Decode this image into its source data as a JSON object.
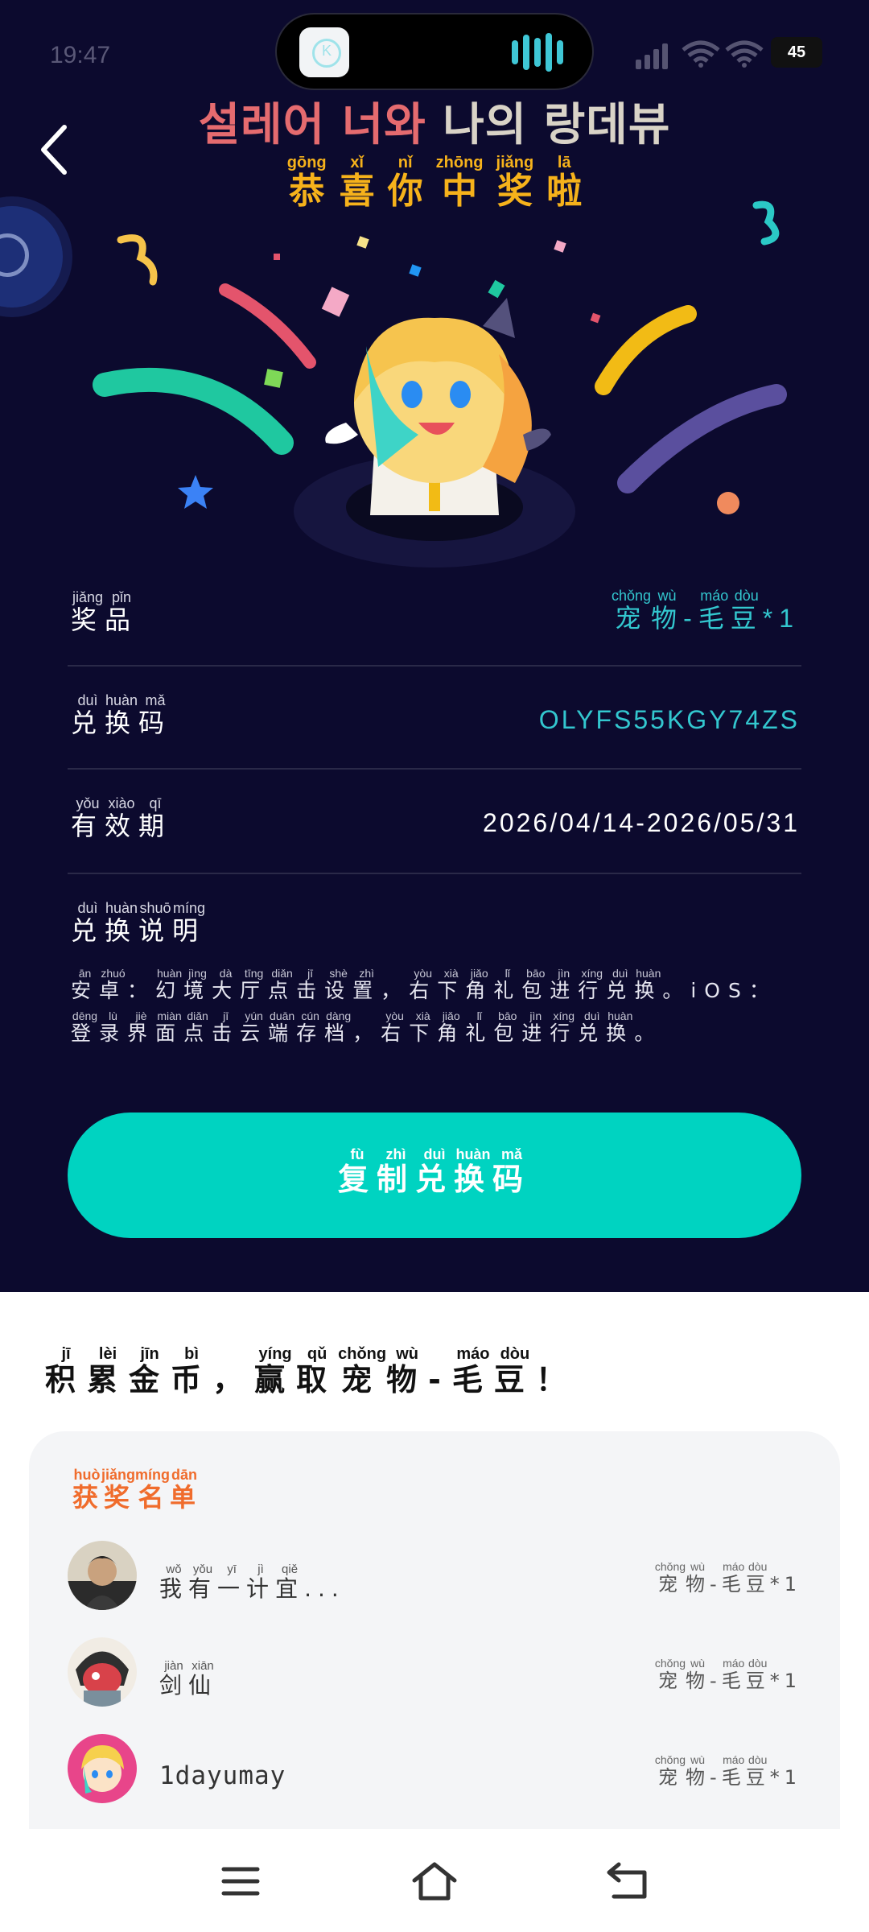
{
  "status_bar": {
    "time": "19:47",
    "battery": "45"
  },
  "game_title": {
    "part1": "설레어 너와",
    "part2": "나의 랑데뷰"
  },
  "congrats": [
    {
      "c": "恭",
      "p": "gōng"
    },
    {
      "c": "喜",
      "p": "xǐ"
    },
    {
      "c": "你",
      "p": "nǐ"
    },
    {
      "c": "中",
      "p": "zhōng"
    },
    {
      "c": "奖",
      "p": "jiǎng"
    },
    {
      "c": "啦",
      "p": "lā"
    }
  ],
  "rows": [
    {
      "label": [
        {
          "c": "奖",
          "p": "jiǎng"
        },
        {
          "c": "品",
          "p": "pǐn"
        }
      ],
      "value_ruby": [
        {
          "c": "宠",
          "p": "chǒng"
        },
        {
          "c": "物",
          "p": "wù"
        },
        {
          "c": "-",
          "p": ""
        },
        {
          "c": "毛",
          "p": "máo"
        },
        {
          "c": "豆",
          "p": "dòu"
        },
        {
          "c": "*1",
          "p": ""
        }
      ]
    },
    {
      "label": [
        {
          "c": "兑",
          "p": "duì"
        },
        {
          "c": "换",
          "p": "huàn"
        },
        {
          "c": "码",
          "p": "mǎ"
        }
      ],
      "value": "OLYFS55KGY74ZS"
    },
    {
      "label": [
        {
          "c": "有",
          "p": "yǒu"
        },
        {
          "c": "效",
          "p": "xiào"
        },
        {
          "c": "期",
          "p": "qī"
        }
      ],
      "value": "2026/04/14-2026/05/31"
    }
  ],
  "explain": {
    "title": [
      {
        "c": "兑",
        "p": "duì"
      },
      {
        "c": "换",
        "p": "huàn"
      },
      {
        "c": "说",
        "p": "shuō"
      },
      {
        "c": "明",
        "p": "míng"
      }
    ],
    "line1": [
      {
        "c": "安",
        "p": "ān"
      },
      {
        "c": "卓",
        "p": "zhuó"
      },
      {
        "c": "：",
        "p": ""
      },
      {
        "c": "幻",
        "p": "huàn"
      },
      {
        "c": "境",
        "p": "jìng"
      },
      {
        "c": "大",
        "p": "dà"
      },
      {
        "c": "厅",
        "p": "tīng"
      },
      {
        "c": "点",
        "p": "diǎn"
      },
      {
        "c": "击",
        "p": "jī"
      },
      {
        "c": "设",
        "p": "shè"
      },
      {
        "c": "置",
        "p": "zhì"
      },
      {
        "c": "，",
        "p": ""
      },
      {
        "c": "右",
        "p": "yòu"
      },
      {
        "c": "下",
        "p": "xià"
      },
      {
        "c": "角",
        "p": "jiǎo"
      },
      {
        "c": "礼",
        "p": "lǐ"
      },
      {
        "c": "包",
        "p": "bāo"
      },
      {
        "c": "进",
        "p": "jìn"
      },
      {
        "c": "行",
        "p": "xíng"
      },
      {
        "c": "兑",
        "p": "duì"
      },
      {
        "c": "换",
        "p": "huàn"
      },
      {
        "c": "。",
        "p": ""
      },
      {
        "c": "iOS：",
        "p": ""
      }
    ],
    "line2": [
      {
        "c": "登",
        "p": "dēng"
      },
      {
        "c": "录",
        "p": "lù"
      },
      {
        "c": "界",
        "p": "jiè"
      },
      {
        "c": "面",
        "p": "miàn"
      },
      {
        "c": "点",
        "p": "diǎn"
      },
      {
        "c": "击",
        "p": "jī"
      },
      {
        "c": "云",
        "p": "yún"
      },
      {
        "c": "端",
        "p": "duān"
      },
      {
        "c": "存",
        "p": "cún"
      },
      {
        "c": "档",
        "p": "dàng"
      },
      {
        "c": "，",
        "p": ""
      },
      {
        "c": "右",
        "p": "yòu"
      },
      {
        "c": "下",
        "p": "xià"
      },
      {
        "c": "角",
        "p": "jiǎo"
      },
      {
        "c": "礼",
        "p": "lǐ"
      },
      {
        "c": "包",
        "p": "bāo"
      },
      {
        "c": "进",
        "p": "jìn"
      },
      {
        "c": "行",
        "p": "xíng"
      },
      {
        "c": "兑",
        "p": "duì"
      },
      {
        "c": "换",
        "p": "huàn"
      },
      {
        "c": "。",
        "p": ""
      }
    ]
  },
  "copy_button": [
    {
      "c": "复",
      "p": "fù"
    },
    {
      "c": "制",
      "p": "zhì"
    },
    {
      "c": "兑",
      "p": "duì"
    },
    {
      "c": "换",
      "p": "huàn"
    },
    {
      "c": "码",
      "p": "mǎ"
    }
  ],
  "headline": [
    {
      "c": "积",
      "p": "jī"
    },
    {
      "c": "累",
      "p": "lèi"
    },
    {
      "c": "金",
      "p": "jīn"
    },
    {
      "c": "币",
      "p": "bì"
    },
    {
      "c": "，",
      "p": ""
    },
    {
      "c": "赢",
      "p": "yíng"
    },
    {
      "c": "取",
      "p": "qǔ"
    },
    {
      "c": "宠",
      "p": "chǒng"
    },
    {
      "c": "物",
      "p": "wù"
    },
    {
      "c": "-",
      "p": ""
    },
    {
      "c": "毛",
      "p": "máo"
    },
    {
      "c": "豆",
      "p": "dòu"
    },
    {
      "c": "！",
      "p": ""
    }
  ],
  "winners": {
    "title": [
      {
        "c": "获",
        "p": "huò"
      },
      {
        "c": "奖",
        "p": "jiǎng"
      },
      {
        "c": "名",
        "p": "míng"
      },
      {
        "c": "单",
        "p": "dān"
      }
    ],
    "prize": [
      {
        "c": "宠",
        "p": "chǒng"
      },
      {
        "c": "物",
        "p": "wù"
      },
      {
        "c": "-",
        "p": ""
      },
      {
        "c": "毛",
        "p": "máo"
      },
      {
        "c": "豆",
        "p": "dòu"
      },
      {
        "c": "*1",
        "p": ""
      }
    ],
    "items": [
      {
        "name_ruby": [
          {
            "c": "我",
            "p": "wǒ"
          },
          {
            "c": "有",
            "p": "yǒu"
          },
          {
            "c": "一",
            "p": "yī"
          },
          {
            "c": "计",
            "p": "jì"
          },
          {
            "c": "宜",
            "p": "qiě"
          },
          {
            "c": "...",
            "p": ""
          }
        ]
      },
      {
        "name_ruby": [
          {
            "c": "剑",
            "p": "jiàn"
          },
          {
            "c": "仙",
            "p": "xiān"
          }
        ]
      },
      {
        "name": "1dayumay"
      }
    ]
  },
  "colors": {
    "background_dark": "#0c0a2e",
    "accent_teal": "#00d3c1",
    "title_gold": "#f6b21b",
    "winners_title": "#f06c2c"
  },
  "icons": [
    "back-arrow-icon",
    "menu-icon",
    "home-icon",
    "return-icon"
  ]
}
